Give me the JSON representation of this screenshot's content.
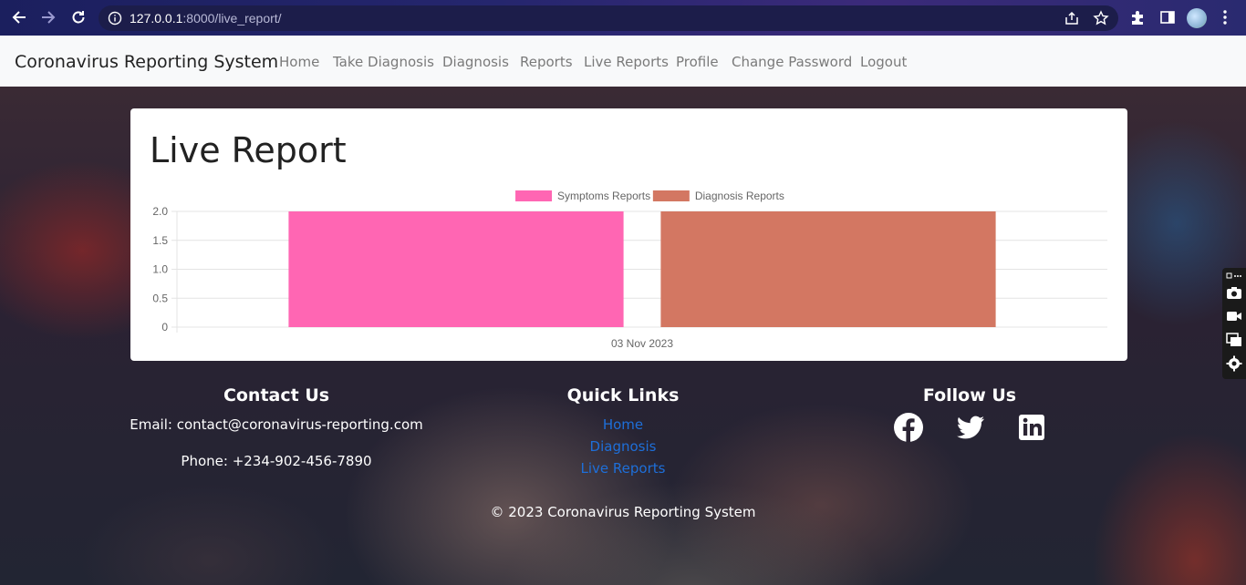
{
  "browser": {
    "url_host": "127.0.0.1",
    "url_rest": ":8000/live_report/"
  },
  "navbar": {
    "brand": "Coronavirus Reporting System",
    "links": [
      "Home",
      "Take Diagnosis",
      "Diagnosis",
      "Reports",
      "Live Reports",
      "Profile",
      "Change Password",
      "Logout"
    ]
  },
  "card": {
    "title": "Live Report"
  },
  "chart_data": {
    "type": "bar",
    "categories": [
      "03 Nov 2023"
    ],
    "series": [
      {
        "name": "Symptoms Reports",
        "values": [
          2
        ],
        "color": "#ff66b3"
      },
      {
        "name": "Diagnosis Reports",
        "values": [
          2
        ],
        "color": "#d37762"
      }
    ],
    "yticks": [
      "0",
      "0.5",
      "1.0",
      "1.5",
      "2.0"
    ],
    "ylim": [
      0,
      2
    ],
    "legend": "top-center",
    "grid": true
  },
  "footer": {
    "contact": {
      "heading": "Contact Us",
      "email": "Email: contact@coronavirus-reporting.com",
      "phone": "Phone: +234-902-456-7890"
    },
    "quick_links": {
      "heading": "Quick Links",
      "links": [
        "Home",
        "Diagnosis",
        "Live Reports"
      ]
    },
    "follow": {
      "heading": "Follow Us",
      "icons": [
        "facebook-icon",
        "twitter-icon",
        "linkedin-icon"
      ]
    },
    "copyright": "© 2023 Coronavirus Reporting System"
  }
}
